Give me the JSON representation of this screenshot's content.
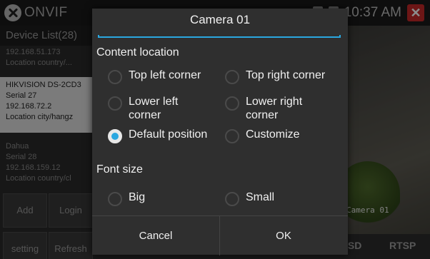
{
  "app": {
    "title": "ONVIF",
    "clock": "10:37 AM",
    "close_glyph": "✕"
  },
  "sidebar": {
    "header": "Device List(28)",
    "devices": [
      {
        "line1": "192.168.51.173",
        "line2": "Location  country/..."
      },
      {
        "name": "HIKVISION DS-2CD3",
        "serial": "Serial  27",
        "ip": "192.168.72.2",
        "location": "Location  city/hangz"
      },
      {
        "name": "Dahua",
        "serial": "Serial  28",
        "ip": "192.168.159.12",
        "location": "Location  country/cl"
      }
    ],
    "buttons": {
      "add": "Add",
      "login": "Login",
      "setting": "setting",
      "refresh": "Refresh"
    }
  },
  "video": {
    "osd_text": "Camera 01",
    "bottom_bar": {
      "osd": "OSD",
      "rtsp": "RTSP"
    }
  },
  "dialog": {
    "title": "Camera 01",
    "content_location_label": "Content location",
    "options": {
      "top_left": "Top left corner",
      "top_right": "Top right corner",
      "lower_left": "Lower left corner",
      "lower_right": "Lower right corner",
      "default_position": "Default position",
      "customize": "Customize"
    },
    "selected_location": "default_position",
    "font_size_label": "Font size",
    "font_options": {
      "big": "Big",
      "small": "Small"
    },
    "selected_font": "",
    "cancel_label": "Cancel",
    "ok_label": "OK",
    "accent_color": "#2aa7e0"
  }
}
